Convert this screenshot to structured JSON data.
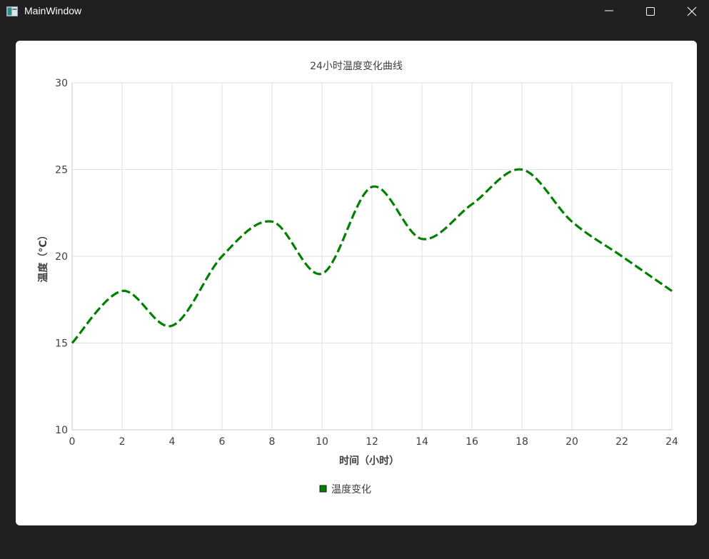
{
  "window": {
    "title": "MainWindow",
    "icons": [
      "app-window-icon",
      "minimize-icon",
      "maximize-icon",
      "close-icon"
    ]
  },
  "chart_data": {
    "type": "line",
    "title": "24小时温度变化曲线",
    "xlabel": "时间（小时）",
    "ylabel": "温度（°C）",
    "xlim": [
      0,
      24
    ],
    "ylim": [
      10,
      30
    ],
    "x_ticks": [
      "0",
      "2",
      "4",
      "6",
      "8",
      "10",
      "12",
      "14",
      "16",
      "18",
      "20",
      "22",
      "24"
    ],
    "y_ticks": [
      "10",
      "15",
      "20",
      "25",
      "30"
    ],
    "grid": true,
    "legend": "bottom-center",
    "series": [
      {
        "name": "温度变化",
        "color": "#008000",
        "line_style": "dashed",
        "smooth": true,
        "x": [
          0,
          2,
          4,
          6,
          8,
          10,
          12,
          14,
          16,
          18,
          20,
          22,
          24
        ],
        "y": [
          15,
          18,
          16,
          20,
          22,
          19,
          24,
          21,
          23,
          25,
          22,
          20,
          18
        ]
      }
    ]
  }
}
